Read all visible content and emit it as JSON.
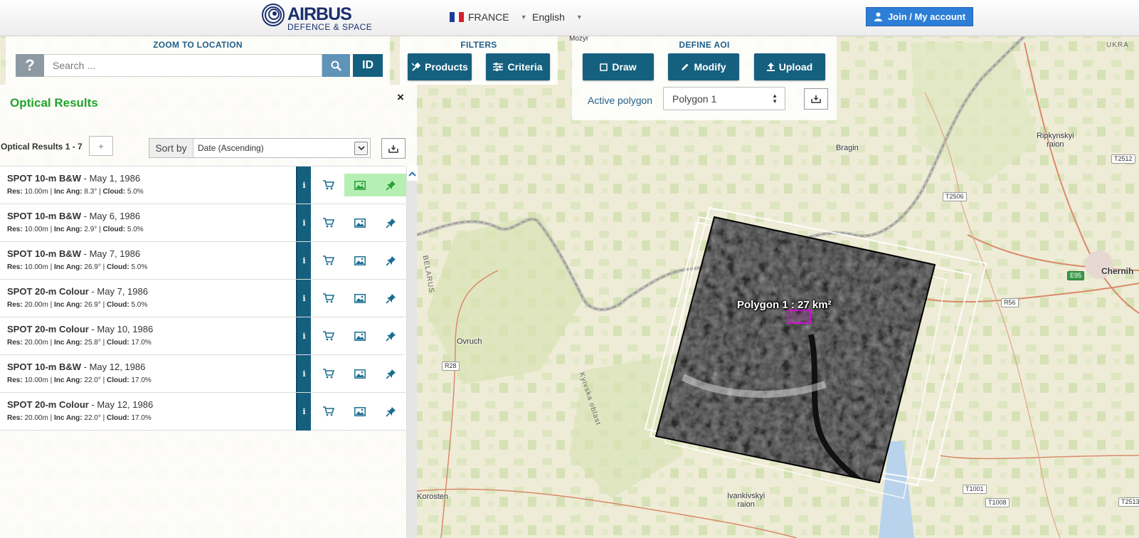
{
  "header": {
    "logo_name": "AIRBUS",
    "logo_sub": "DEFENCE & SPACE",
    "country": "FRANCE",
    "language": "English",
    "join_label": "Join / My account"
  },
  "zoom": {
    "title": "ZOOM TO LOCATION",
    "help_label": "?",
    "search_placeholder": "Search ...",
    "id_label": "ID"
  },
  "filters": {
    "title": "FILTERS",
    "products_label": "Products",
    "criteria_label": "Criteria"
  },
  "aoi": {
    "title": "DEFINE AOI",
    "draw_label": "Draw",
    "modify_label": "Modify",
    "upload_label": "Upload",
    "active_polygon_label": "Active polygon",
    "active_polygon_value": "Polygon 1"
  },
  "results": {
    "title": "Optical Results",
    "close": "×",
    "count": "Optical Results 1 - 7",
    "plus": "+",
    "sort_label": "Sort by",
    "sort_value": "Date (Ascending)",
    "items": [
      {
        "name": "SPOT 10-m B&W",
        "date": " - May 1, 1986",
        "res": "10.00m",
        "inc": "8.3°",
        "cloud": "5.0%",
        "active": true
      },
      {
        "name": "SPOT 10-m B&W",
        "date": " - May 6, 1986",
        "res": "10.00m",
        "inc": "2.9°",
        "cloud": "5.0%",
        "active": false
      },
      {
        "name": "SPOT 10-m B&W",
        "date": " - May 7, 1986",
        "res": "10.00m",
        "inc": "26.9°",
        "cloud": "5.0%",
        "active": false
      },
      {
        "name": "SPOT 20-m Colour",
        "date": " - May 7, 1986",
        "res": "20.00m",
        "inc": "26.9°",
        "cloud": "5.0%",
        "active": false
      },
      {
        "name": "SPOT 20-m Colour",
        "date": " - May 10, 1986",
        "res": "20.00m",
        "inc": "25.8°",
        "cloud": "17.0%",
        "active": false
      },
      {
        "name": "SPOT 10-m B&W",
        "date": " - May 12, 1986",
        "res": "10.00m",
        "inc": "22.0°",
        "cloud": "17.0%",
        "active": false
      },
      {
        "name": "SPOT 20-m Colour",
        "date": " - May 12, 1986",
        "res": "20.00m",
        "inc": "22.0°",
        "cloud": "17.0%",
        "active": false
      }
    ],
    "meta_labels": {
      "res": "Res:",
      "inc": "Inc Ang:",
      "cloud": "Cloud:"
    }
  },
  "map": {
    "polygon_label": "Polygon 1 : 27 km²",
    "places": {
      "bragin": "Bragin",
      "ripkynskyi": "Ripkynskyi\nraion",
      "chernihiv": "Chernih",
      "ovruch": "Ovruch",
      "korosten": "Korosten",
      "ivankivskyi": "Ivankivskyi\nraion",
      "mozyr": "Mozyr"
    },
    "regions": {
      "belarus": "BELARUS",
      "kyivska": "Kyivska oblast",
      "ukraine": "UKRA"
    },
    "roads": {
      "t2512": "T2512",
      "t2506": "T2506",
      "e95": "E95",
      "r56": "R56",
      "r28": "R28",
      "t1001": "T1001",
      "t1008": "T1008",
      "t2513": "T2513"
    }
  }
}
